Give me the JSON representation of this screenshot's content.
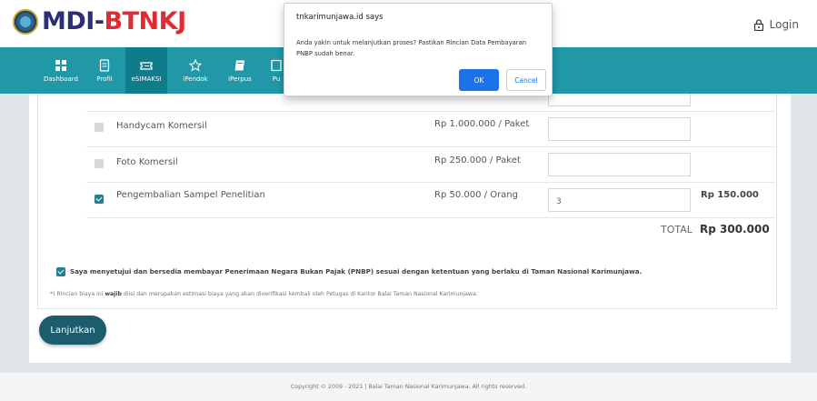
{
  "header": {
    "logo_prefix": "MDI-",
    "logo_suffix": "BTNKJ",
    "login_label": "Login"
  },
  "nav": {
    "items": [
      {
        "label": "Dashboard",
        "icon": "dashboard-icon"
      },
      {
        "label": "Profil",
        "icon": "document-icon"
      },
      {
        "label": "eSIMAKSI",
        "icon": "ticket-icon"
      },
      {
        "label": "iPendok",
        "icon": "star-icon"
      },
      {
        "label": "iPerpus",
        "icon": "book-icon"
      },
      {
        "label": "Pu",
        "icon": "more-icon"
      }
    ],
    "active_color": "#0f7c8c",
    "bar_color": "#2098a8"
  },
  "items": [
    {
      "label": "Handycam Komersil",
      "price": "Rp 1.000.000 / Paket",
      "checked": false,
      "qty": "",
      "subtotal": ""
    },
    {
      "label": "Foto Komersil",
      "price": "Rp 250.000 / Paket",
      "checked": false,
      "qty": "",
      "subtotal": ""
    },
    {
      "label": "Pengembalian Sampel Penelitian",
      "price": "Rp 50.000 / Orang",
      "checked": true,
      "qty": "3",
      "subtotal": "Rp 150.000"
    }
  ],
  "total": {
    "label": "TOTAL",
    "value": "Rp 300.000"
  },
  "agreement": {
    "checked": true,
    "text": "Saya menyetujui dan bersedia membayar Penerimaan Negara Bukan Pajak (PNBP) sesuai dengan ketentuan yang berlaku di Taman Nasional Karimunjawa."
  },
  "note": {
    "prefix": "*) Rincian biaya ini ",
    "bold": "wajib",
    "suffix": " diisi dan merupakan estimasi biaya yang akan diverifikasi kembali oleh Petugas di Kantor Balai Taman Nasional Karimunjawa."
  },
  "continue_label": "Lanjutkan",
  "footer_text": "Copyright © 2009 - 2021 | Balai Taman Nasional Karimunjawa. All rights reserved.",
  "dialog": {
    "title": "tnkarimunjawa.id says",
    "message": "Anda yakin untuk melanjutkan proses? Pastikan Rincian Data Pembayaran PNBP sudah benar.",
    "ok_label": "OK",
    "cancel_label": "Cancel"
  }
}
